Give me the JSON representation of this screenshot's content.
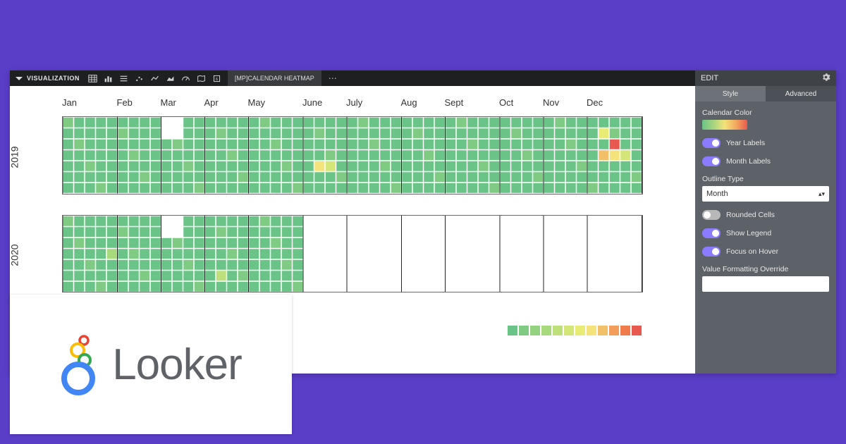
{
  "toolbar": {
    "title": "VISUALIZATION",
    "active_tab": "[MP]CALENDAR HEATMAP"
  },
  "edit_panel": {
    "header": "EDIT",
    "tabs": {
      "style": "Style",
      "advanced": "Advanced",
      "active": "style"
    },
    "color_label": "Calendar Color",
    "toggles": {
      "year_labels": {
        "label": "Year Labels",
        "on": true
      },
      "month_labels": {
        "label": "Month Labels",
        "on": true
      },
      "rounded": {
        "label": "Rounded Cells",
        "on": false
      },
      "show_legend": {
        "label": "Show Legend",
        "on": true
      },
      "focus_hover": {
        "label": "Focus on Hover",
        "on": true
      }
    },
    "outline_label": "Outline Type",
    "outline_value": "Month",
    "value_fmt_label": "Value Formatting Override",
    "value_fmt_value": ""
  },
  "logo_text": "Looker",
  "months": [
    "Jan",
    "Feb",
    "Mar",
    "Apr",
    "May",
    "June",
    "July",
    "Aug",
    "Sept",
    "Oct",
    "Nov",
    "Dec"
  ],
  "years": [
    "2019",
    "2020"
  ],
  "chart_data": {
    "type": "heatmap",
    "description": "Calendar heatmap, one row per year (7 rows × 53 weeks), cells colored by value on a green→yellow→red scale. 2019 is fully populated; 2020 is populated through roughly May with the rest blank.",
    "legend_colors": [
      "#6bc487",
      "#7fcb83",
      "#93d280",
      "#a7d97d",
      "#bde07a",
      "#d3e677",
      "#e9ec74",
      "#f4e27a",
      "#f3c06a",
      "#f29e5a",
      "#f07c4b",
      "#e85a4f"
    ],
    "month_boundaries_2019": [
      0,
      5,
      9,
      13,
      17,
      22,
      26,
      31,
      35,
      40,
      44,
      48,
      53
    ],
    "years": [
      {
        "year": "2019",
        "weeks": 53,
        "hotspots": [
          {
            "week": 23,
            "dow": 4,
            "level": 7
          },
          {
            "week": 24,
            "dow": 4,
            "level": 5
          },
          {
            "week": 49,
            "dow": 1,
            "level": 6
          },
          {
            "week": 49,
            "dow": 3,
            "level": 8
          },
          {
            "week": 50,
            "dow": 2,
            "level": 11
          },
          {
            "week": 50,
            "dow": 3,
            "level": 7
          },
          {
            "week": 51,
            "dow": 3,
            "level": 5
          }
        ],
        "blank_ranges": [
          {
            "week_from": 9,
            "week_to": 10,
            "dow_from": 0,
            "dow_to": 1
          }
        ]
      },
      {
        "year": "2020",
        "weeks": 53,
        "populated_until_week": 22,
        "hotspots": [
          {
            "week": 4,
            "dow": 3,
            "level": 3
          },
          {
            "week": 14,
            "dow": 5,
            "level": 4
          }
        ],
        "blank_ranges": [
          {
            "week_from": 9,
            "week_to": 10,
            "dow_from": 0,
            "dow_to": 1
          }
        ]
      }
    ]
  }
}
